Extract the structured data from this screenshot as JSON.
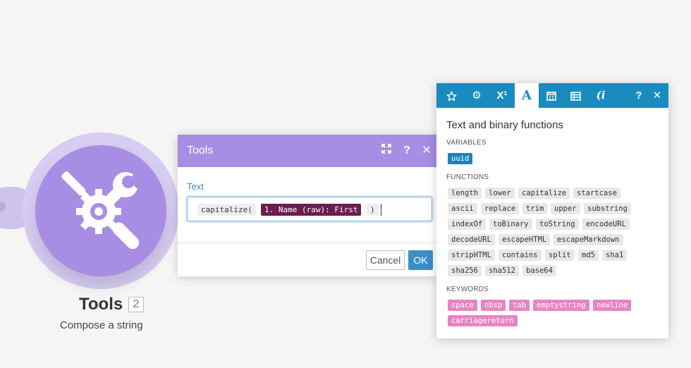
{
  "module": {
    "title": "Tools",
    "badge": "2",
    "subtitle": "Compose a string"
  },
  "dialog": {
    "title": "Tools",
    "field_label": "Text",
    "tokens": {
      "function_open": "capitalize(",
      "variable": "1. Name (raw): First",
      "function_close": ")"
    },
    "cancel_label": "Cancel",
    "ok_label": "OK"
  },
  "panel": {
    "heading": "Text and binary functions",
    "variables_label": "VARIABLES",
    "variables": [
      "uuid"
    ],
    "functions_label": "FUNCTIONS",
    "functions": [
      "length",
      "lower",
      "capitalize",
      "startcase",
      "ascii",
      "replace",
      "trim",
      "upper",
      "substring",
      "indexOf",
      "toBinary",
      "toString",
      "encodeURL",
      "decodeURL",
      "escapeHTML",
      "escapeMarkdown",
      "stripHTML",
      "contains",
      "split",
      "md5",
      "sha1",
      "sha256",
      "sha512",
      "base64"
    ],
    "keywords_label": "KEYWORDS",
    "keywords": [
      "space",
      "nbsp",
      "tab",
      "emptystring",
      "newline",
      "carriagereturn"
    ],
    "toolbar_active_glyph": "A",
    "toolbar_superscript": "X¹"
  },
  "colors": {
    "module_purple": "#a78de3",
    "panel_blue": "#1a8bbf",
    "variable_token": "#6b1d4f",
    "keyword_pink": "#e785c2"
  },
  "icons": [
    "tools-icon",
    "expand-icon",
    "help-icon",
    "close-icon",
    "star-icon",
    "gear-icon",
    "superscript-icon",
    "text-icon",
    "calendar-icon",
    "table-icon",
    "info-icon"
  ]
}
